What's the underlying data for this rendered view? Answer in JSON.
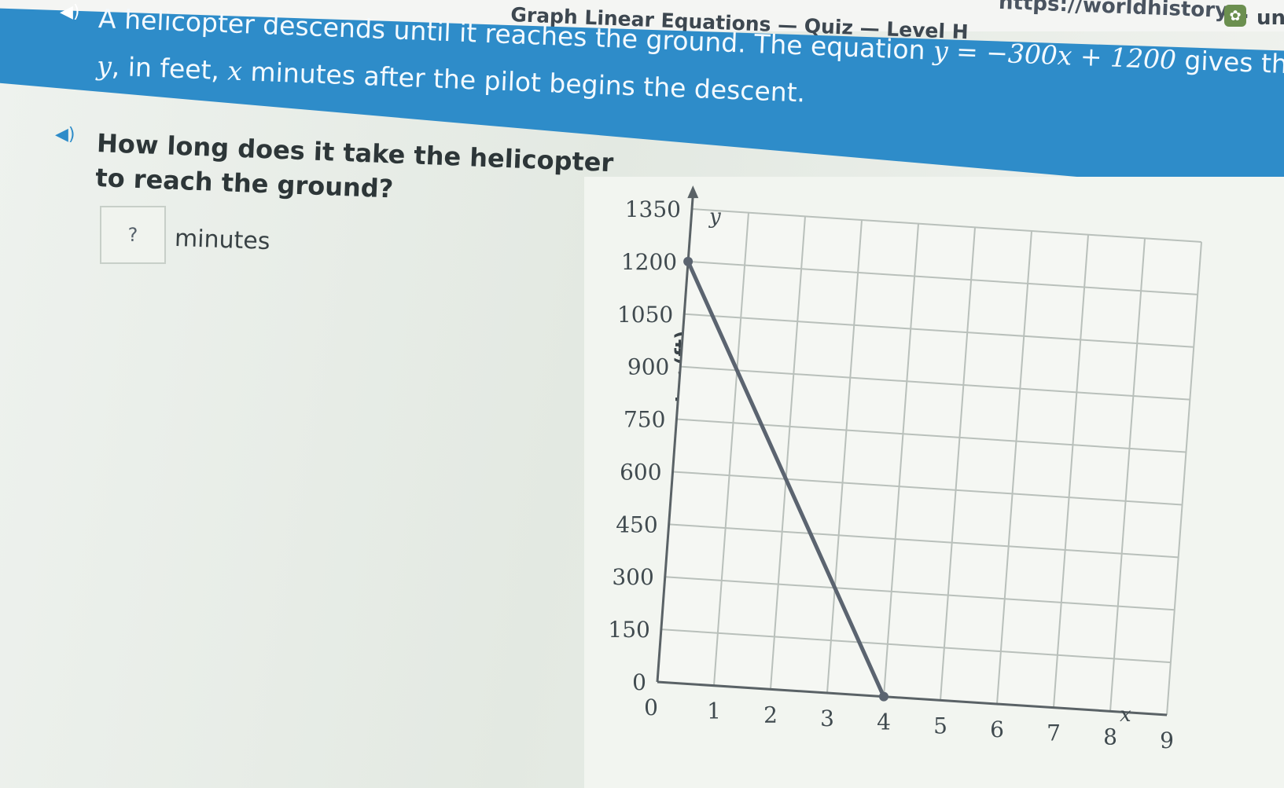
{
  "browser": {
    "quiz_title": "Graph Linear Equations — Quiz — Level H",
    "url_text": "https://worldhistory...",
    "extension_label": "un"
  },
  "problem": {
    "line1": "A helicopter descends until it reaches the ground. The equation",
    "equation": "y = −300x + 1200",
    "line1_end": "gives the heigh",
    "line2_var_y": "y",
    "line2_mid": ", in feet,",
    "line2_var_x": "x",
    "line2_end": "minutes after the pilot begins the descent."
  },
  "question": {
    "line1": "How long does it take the helicopter",
    "line2": "to reach the ground?"
  },
  "answer": {
    "placeholder": "?",
    "unit": "minutes"
  },
  "chart_data": {
    "type": "line",
    "ylabel": "Height of Helicopter (ft)",
    "x_axis_name": "x",
    "y_axis_name": "y",
    "x_ticks": [
      "0",
      "1",
      "2",
      "3",
      "4",
      "5",
      "6",
      "7",
      "8",
      "9"
    ],
    "y_ticks": [
      "0",
      "150",
      "300",
      "450",
      "600",
      "750",
      "900",
      "1050",
      "1200",
      "1350"
    ],
    "xlim": [
      0,
      9
    ],
    "ylim": [
      0,
      1350
    ],
    "grid": true,
    "series": [
      {
        "points": [
          [
            0,
            1200
          ],
          [
            4,
            0
          ]
        ],
        "color": "#5b6470"
      }
    ]
  },
  "colors": {
    "banner": "#2e8cc9",
    "speaker_icon": "#2e8cc9"
  }
}
